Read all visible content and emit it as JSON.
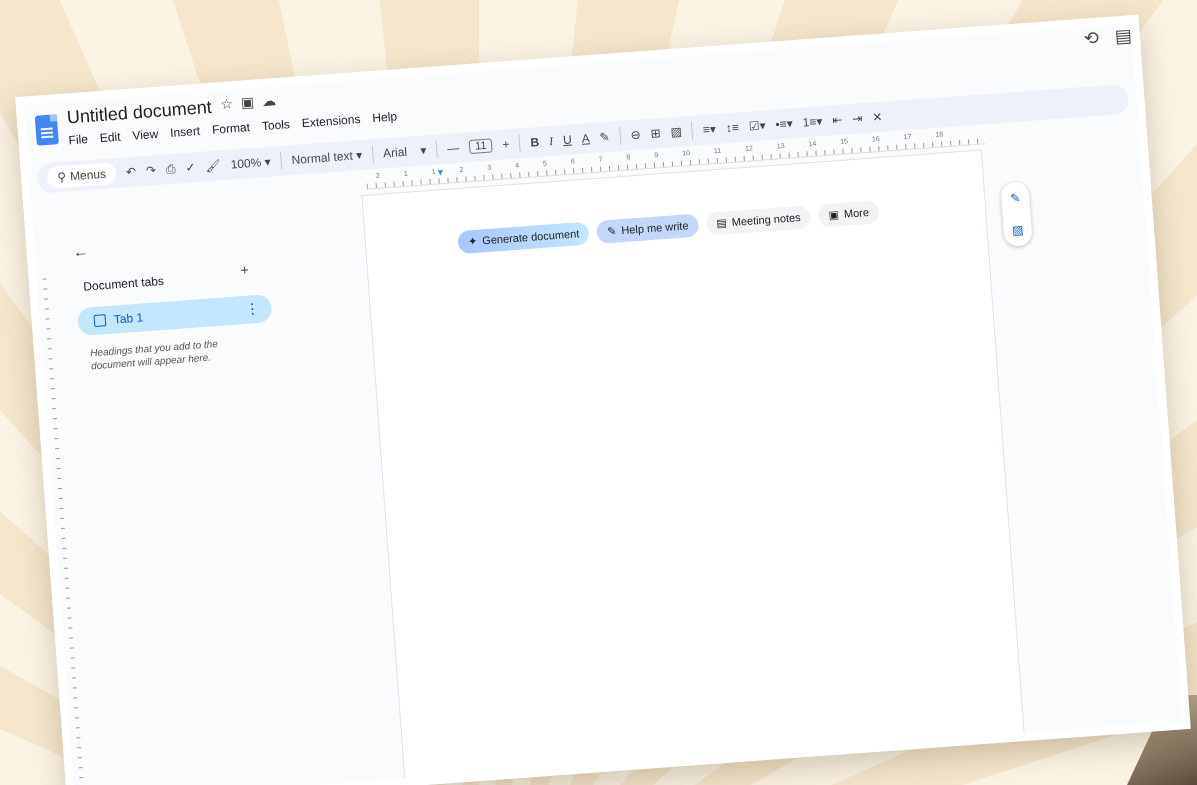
{
  "app": {
    "title": "Untitled document",
    "menu": [
      "File",
      "Edit",
      "View",
      "Insert",
      "Format",
      "Tools",
      "Extensions",
      "Help"
    ]
  },
  "toolbar": {
    "search_label": "Menus",
    "zoom": "100%",
    "style": "Normal text",
    "font": "Arial",
    "font_size": "11",
    "bold": "B",
    "italic": "I",
    "underline": "U",
    "text_color": "A"
  },
  "ruler": {
    "numbers": [
      "2",
      "1",
      "1",
      "2",
      "3",
      "4",
      "5",
      "6",
      "7",
      "8",
      "9",
      "10",
      "11",
      "12",
      "13",
      "14",
      "15",
      "16",
      "17",
      "18"
    ]
  },
  "sidebar": {
    "title": "Document tabs",
    "tab_label": "Tab 1",
    "hint": "Headings that you add to the document will appear here."
  },
  "chips": {
    "generate": "Generate document",
    "help": "Help me write",
    "meeting": "Meeting notes",
    "more": "More"
  },
  "colors": {
    "accent": "#0b57d0",
    "tab_bg": "#c2e7ff",
    "toolbar_bg": "#edf2fa"
  }
}
